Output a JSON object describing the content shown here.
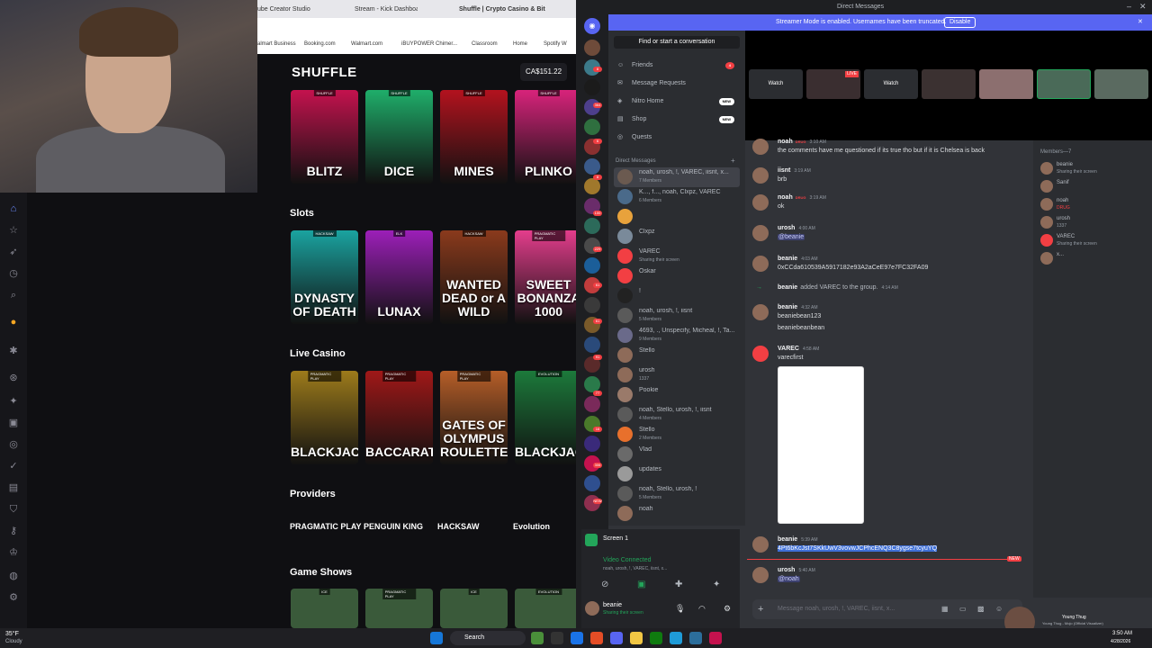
{
  "browser": {
    "tabs": [
      "ube Creator Studio",
      "Stream - Kick Dashboard",
      "Shuffle | Crypto Casino & Bitco"
    ],
    "bookmarks": [
      "almart Business",
      "Booking.com",
      "Walmart.com",
      "iBUYPOWER Chimer...",
      "Classroom",
      "Home",
      "Spotify W"
    ]
  },
  "casino": {
    "logo": "SHUFFLE",
    "balance": "CA$151.22",
    "originals": [
      {
        "label": "BLITZ",
        "tag": "SHUFFLE",
        "color": "#c4124e"
      },
      {
        "label": "DICE",
        "tag": "SHUFFLE",
        "color": "#1fae6a"
      },
      {
        "label": "MINES",
        "tag": "SHUFFLE",
        "color": "#b3121e"
      },
      {
        "label": "PLINKO",
        "tag": "SHUFFLE",
        "color": "#d8237b"
      }
    ],
    "slots_title": "Slots",
    "slots": [
      {
        "label": "DYNASTY OF DEATH",
        "tag": "HACKSAW",
        "color": "#1aa3a0"
      },
      {
        "label": "LUNAX",
        "tag": "ELK",
        "color": "#9c1fb8"
      },
      {
        "label": "WANTED DEAD or A WILD",
        "tag": "HACKSAW",
        "color": "#8a3a1c"
      },
      {
        "label": "SWEET BONANZA 1000",
        "tag": "PRAGMATIC PLAY",
        "color": "#e43d8c"
      }
    ],
    "live_title": "Live Casino",
    "live": [
      {
        "label": "BLACKJACK",
        "tag": "PRAGMATIC PLAY",
        "color": "#9d7b1b"
      },
      {
        "label": "BACCARAT",
        "tag": "PRAGMATIC PLAY",
        "color": "#a01818"
      },
      {
        "label": "GATES OF OLYMPUS ROULETTE",
        "tag": "PRAGMATIC PLAY",
        "color": "#b65e28"
      },
      {
        "label": "BLACKJACK",
        "tag": "EVOLUTION",
        "color": "#1c7a3b"
      }
    ],
    "providers_title": "Providers",
    "providers": [
      "PRAGMATIC PLAY",
      "PENGUIN KING",
      "HACKSAW",
      "Evolution"
    ],
    "gameshows_title": "Game Shows",
    "gameshow_tags": [
      "ICE",
      "PRAGMATIC PLAY",
      "ICE",
      "EVOLUTION"
    ]
  },
  "discord": {
    "window_title": "Direct Messages",
    "streamer_banner": "Streamer Mode is enabled. Usernames have been truncated.",
    "disable_label": "Disable",
    "search_placeholder": "Find or start a conversation",
    "nav": [
      {
        "label": "Friends",
        "badge": "4"
      },
      {
        "label": "Message Requests",
        "badge": ""
      },
      {
        "label": "Nitro Home",
        "badge": "NEW"
      },
      {
        "label": "Shop",
        "badge": "NEW"
      },
      {
        "label": "Quests",
        "badge": ""
      }
    ],
    "dm_header": "Direct Messages",
    "dms": [
      {
        "name": "noah, urosh, !, VAREC, iisnt, x...",
        "sub": "7 Members"
      },
      {
        "name": "K..., f..., noah, Clxpz, VAREC",
        "sub": "6 Members"
      },
      {
        "name": "",
        "sub": ""
      },
      {
        "name": "Clxpz",
        "sub": ""
      },
      {
        "name": "VAREC",
        "sub": "Sharing their screen"
      },
      {
        "name": "Oskar",
        "sub": ""
      },
      {
        "name": "!",
        "sub": ""
      },
      {
        "name": "noah, urosh, !, iisnt",
        "sub": "5 Members"
      },
      {
        "name": "4693, ., Unspecify, Micheal, !, Ta...",
        "sub": "9 Members"
      },
      {
        "name": "Stello",
        "sub": ""
      },
      {
        "name": "urosh",
        "sub": "1337"
      },
      {
        "name": "Pookie",
        "sub": ""
      },
      {
        "name": "noah, Stello, urosh, !, iisnt",
        "sub": "4 Members"
      },
      {
        "name": "Stello",
        "sub": "2 Members"
      },
      {
        "name": "Vlad",
        "sub": ""
      },
      {
        "name": "updates",
        "sub": ""
      },
      {
        "name": "noah, Stello, urosh, !",
        "sub": "5 Members"
      },
      {
        "name": "noah",
        "sub": ""
      }
    ],
    "guild_badges": [
      "8",
      "364",
      "6",
      "8",
      "100",
      "229",
      "61",
      "61",
      "91",
      "77",
      "16",
      "306",
      "NEW"
    ],
    "voice": {
      "screen_label": "Screen 1",
      "status": "Video Connected",
      "channel": "noah, urosh, !, VAREC, iisnt, x...",
      "user": "beanie",
      "user_status": "Sharing their screen"
    },
    "stream_watch_labels": [
      "Watch",
      "Watch"
    ],
    "live_badge": "LIVE",
    "messages": [
      {
        "author": "noah",
        "tag": "DRUG",
        "time": "3:10 AM",
        "text": "the comments have me questioned if its true tho but if it is Chelsea is back"
      },
      {
        "author": "iisnt",
        "tag": "",
        "time": "3:19 AM",
        "text": "brb"
      },
      {
        "author": "noah",
        "tag": "DRUG",
        "time": "3:19 AM",
        "text": "ok"
      },
      {
        "author": "urosh",
        "tag": "",
        "time": "4:00 AM",
        "text": "@beanie"
      },
      {
        "author": "beanie",
        "tag": "",
        "time": "4:03 AM",
        "text": "0xCCda610539A5917182e93A2aCeE97e7FC32FA09"
      },
      {
        "author": "beanie",
        "tag": "",
        "time": "4:14 AM",
        "text": "added VAREC to the group."
      },
      {
        "author": "beanie",
        "tag": "",
        "time": "4:32 AM",
        "text": "beaniebean123"
      },
      {
        "author": "",
        "tag": "",
        "time": "",
        "text": "beaniebeanbean"
      },
      {
        "author": "VAREC",
        "tag": "",
        "time": "4:58 AM",
        "text": "varecfirst"
      },
      {
        "author": "beanie",
        "tag": "",
        "time": "5:39 AM",
        "text": "4Pt6bKcJst7SKkUwV3vovwJCPhcENQ3C8ygse7tcyuYQ"
      },
      {
        "author": "urosh",
        "tag": "",
        "time": "5:40 AM",
        "text": "@noah"
      }
    ],
    "new_marker": "NEW",
    "input_placeholder": "Message noah, urosh, !, VAREC, iisnt, x...",
    "members_header": "Members—7",
    "members": [
      {
        "name": "beanie",
        "sub": "Sharing their screen"
      },
      {
        "name": "Sanif",
        "sub": ""
      },
      {
        "name": "noah",
        "sub": "DRUG"
      },
      {
        "name": "urosh",
        "sub": "1337"
      },
      {
        "name": "VAREC",
        "sub": "Sharing their screen"
      },
      {
        "name": "x...",
        "sub": ""
      }
    ],
    "now_playing_title": "Young Thug",
    "now_playing_sub": "Young Thug - Mojo (Official Visualizer)"
  },
  "taskbar": {
    "weather_temp": "35°F",
    "weather_desc": "Cloudy",
    "search_label": "Search",
    "time": "3:50 AM",
    "date": "4/28/2026"
  }
}
